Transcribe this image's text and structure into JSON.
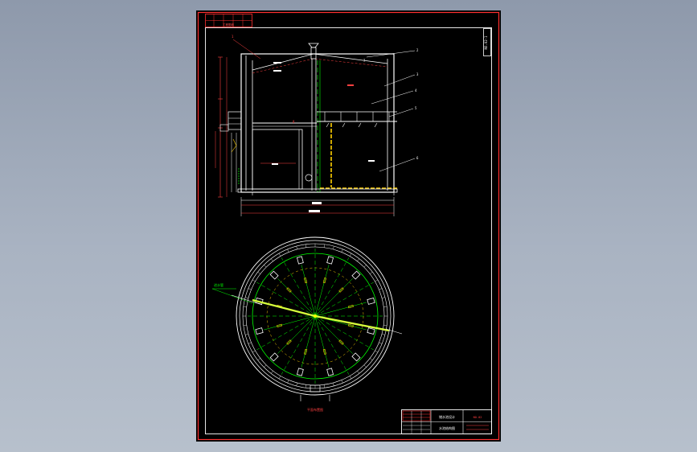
{
  "drawing": {
    "header_stamp": "工程图纸",
    "side_stamp": "NO.02-1",
    "section_labels": [
      "1",
      "2",
      "3",
      "4",
      "5",
      "6",
      "7",
      "8"
    ],
    "plan_caption": "平面布置图",
    "plan_callout": "进水管",
    "title_block": {
      "project": "储水池设计",
      "drawing_title": "水池结构图",
      "drawing_no": "NO.02"
    }
  },
  "colors": {
    "viewport_bg": "#9ba5b5",
    "sheet_bg": "#000000",
    "frame_outer": "#ff3030",
    "frame_inner": "#e6e6e6",
    "structure": "#ffffff",
    "dimension": "#ff4040",
    "grid": "#00ff00",
    "pipe": "#ffd000",
    "highlight": "#d7ff3c"
  }
}
